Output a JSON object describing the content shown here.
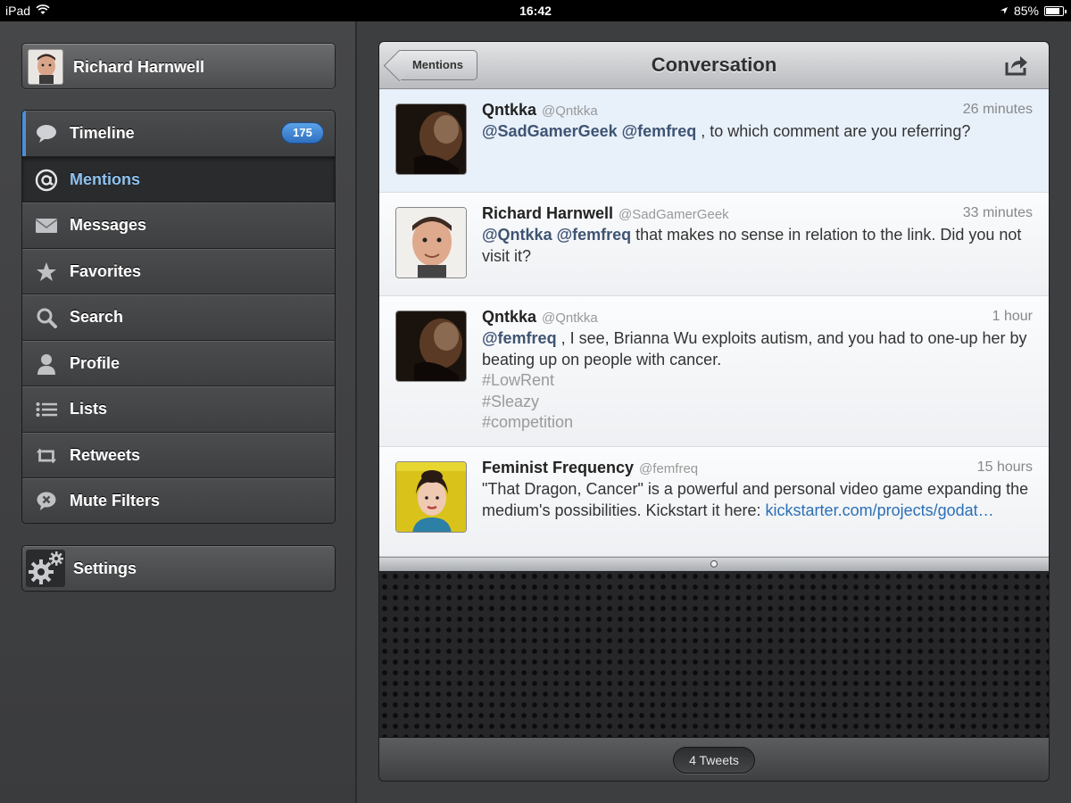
{
  "status_bar": {
    "device": "iPad",
    "time": "16:42",
    "battery": "85%",
    "battery_level": 0.85
  },
  "sidebar": {
    "user": {
      "name": "Richard Harnwell"
    },
    "items": [
      {
        "label": "Timeline",
        "icon": "speech-bubble-icon",
        "badge": "175"
      },
      {
        "label": "Mentions",
        "icon": "at-sign-icon"
      },
      {
        "label": "Messages",
        "icon": "envelope-icon"
      },
      {
        "label": "Favorites",
        "icon": "star-icon"
      },
      {
        "label": "Search",
        "icon": "magnifier-icon"
      },
      {
        "label": "Profile",
        "icon": "person-icon"
      },
      {
        "label": "Lists",
        "icon": "list-icon"
      },
      {
        "label": "Retweets",
        "icon": "retweet-icon"
      },
      {
        "label": "Mute Filters",
        "icon": "mute-icon"
      }
    ],
    "settings_label": "Settings"
  },
  "topbar": {
    "back_label": "Mentions",
    "title": "Conversation"
  },
  "tweets": [
    {
      "name": "Qntkka",
      "handle": "@Qntkka",
      "time": "26 minutes",
      "mentions": "@SadGamerGeek @femfreq",
      "text": " , to which comment are you referring?"
    },
    {
      "name": "Richard Harnwell",
      "handle": "@SadGamerGeek",
      "time": "33 minutes",
      "mentions": "@Qntkka @femfreq",
      "text": " that makes no sense in relation to the link. Did you not visit it?"
    },
    {
      "name": "Qntkka",
      "handle": "@Qntkka",
      "time": "1 hour",
      "mentions": "@femfreq",
      "text": " , I see, Brianna Wu exploits autism, and you had to one-up her by beating up on people with cancer.",
      "hashtags": [
        "#LowRent",
        "#Sleazy",
        "#competition"
      ]
    },
    {
      "name": "Feminist Frequency",
      "handle": "@femfreq",
      "time": "15 hours",
      "text": "\"That Dragon, Cancer\" is a powerful and personal video game expanding the medium's possibilities. Kickstart it here: ",
      "link": "kickstarter.com/projects/godat…"
    }
  ],
  "footer": {
    "count_label": "4 Tweets"
  },
  "colors": {
    "accent": "#4a90d9",
    "badge": "#2f6fbf",
    "mention": "#3f5473",
    "link": "#2b6fb6",
    "highlight": "#e8f0fa"
  }
}
